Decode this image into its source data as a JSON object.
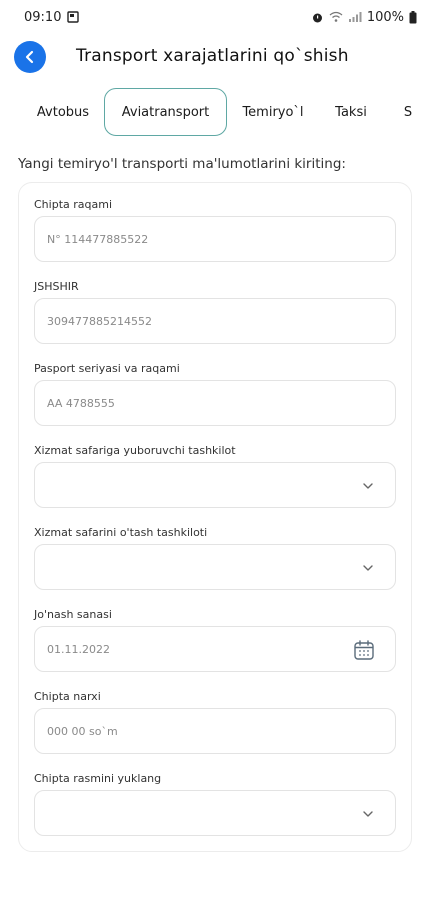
{
  "status_bar": {
    "time": "09:10",
    "battery": "100%"
  },
  "header": {
    "title": "Transport xarajatlarini qo`shish"
  },
  "tabs": [
    {
      "label": "Avtobus",
      "active": false
    },
    {
      "label": "Aviatransport",
      "active": true
    },
    {
      "label": "Temiryo`l",
      "active": false
    },
    {
      "label": "Taksi",
      "active": false
    },
    {
      "label": "S",
      "active": false
    }
  ],
  "section_label": "Yangi temiryo'l transporti ma'lumotlarini kiriting:",
  "form": {
    "ticket_number": {
      "label": "Chipta raqami",
      "placeholder": "N° 114477885522"
    },
    "jshshir": {
      "label": "JSHSHIR",
      "placeholder": "309477885214552"
    },
    "passport": {
      "label": "Pasport seriyasi va raqami",
      "placeholder": "AA 4788555"
    },
    "sending_org": {
      "label": "Xizmat safariga yuboruvchi tashkilot",
      "value": ""
    },
    "host_org": {
      "label": "Xizmat safarini o'tash tashkiloti",
      "value": ""
    },
    "departure_date": {
      "label": "Jo'nash sanasi",
      "placeholder": "01.11.2022"
    },
    "ticket_price": {
      "label": "Chipta narxi",
      "placeholder": "000 00 so`m"
    },
    "ticket_photo": {
      "label": "Chipta rasmini yuklang",
      "value": ""
    }
  },
  "colors": {
    "accent_blue": "#1a73e8",
    "active_tab_border": "#5fa8a4"
  }
}
